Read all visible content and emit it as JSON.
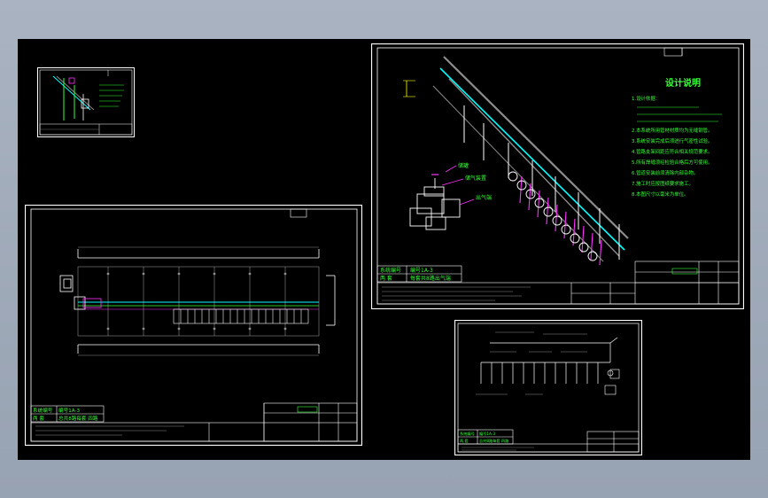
{
  "colors": {
    "background": "#a2acbb",
    "model_space": "#000000",
    "frame": "#ffffff",
    "green": "#39ff39",
    "cyan": "#00ffff",
    "magenta": "#ff33ff",
    "yellow": "#ffff00",
    "dim": "#8c8c8c"
  },
  "sheet_main": {
    "title": "设计说明",
    "labels": {
      "tank": "储罐",
      "manifold": "储气装置",
      "outlet": "出气端"
    },
    "notes": [
      "1.设计依据：",
      "2.本系统所用管材材质均为无缝钢管。",
      "3.系统安装完成后须进行气密性试验。",
      "4.管路支架间距应符合相关规范要求。",
      "5.所有焊缝须经检验合格后方可使用。",
      "6.管道安装前须清除内部杂物。",
      "7.施工时应按图纸要求施工。",
      "8.本图尺寸以毫米为单位。"
    ],
    "table": {
      "row1": [
        "系统编号",
        "编号1A-3"
      ],
      "row2": [
        "两 套",
        "每套共8路出气端"
      ]
    }
  },
  "sheet_plan": {
    "table": {
      "row1": [
        "系统编号",
        "编号1A-3"
      ],
      "row2": [
        "两 套",
        "总共8路每套 四路"
      ]
    }
  },
  "sheet_schematic": {
    "table": {
      "row1": [
        "系统编号",
        "编号1A-3"
      ],
      "row2": [
        "两 套",
        "总共8路每套 四路"
      ]
    }
  }
}
